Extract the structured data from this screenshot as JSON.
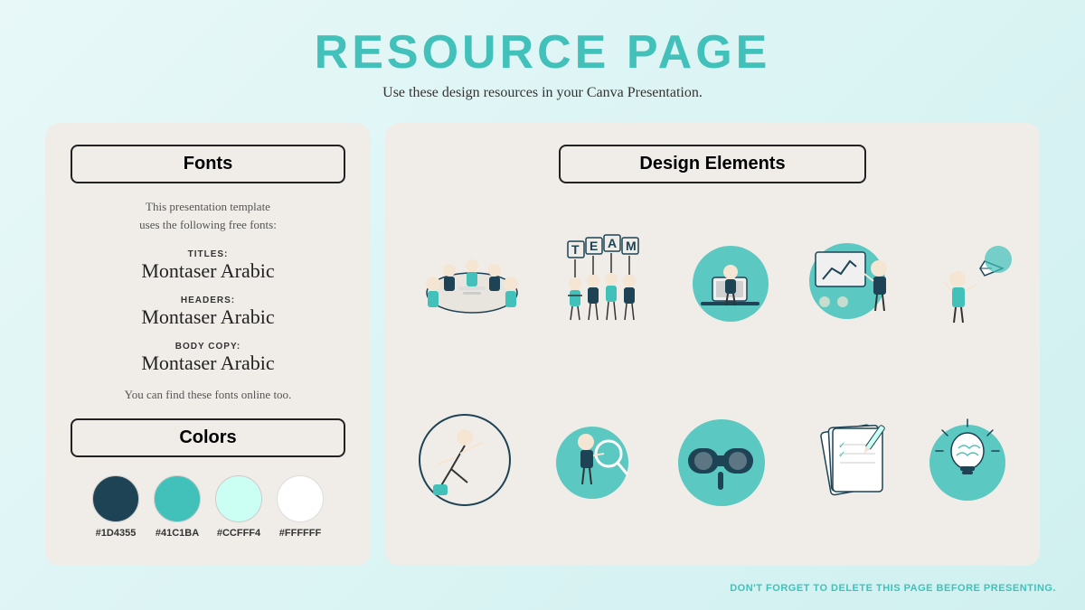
{
  "header": {
    "title": "RESOURCE PAGE",
    "subtitle": "Use these design resources in your Canva Presentation."
  },
  "left_panel": {
    "fonts_badge": "Fonts",
    "fonts_description": "This presentation template\nuses the following free fonts:",
    "font_entries": [
      {
        "label": "TITLES:",
        "name": "Montaser Arabic"
      },
      {
        "label": "HEADERS:",
        "name": "Montaser Arabic"
      },
      {
        "label": "BODY COPY:",
        "name": "Montaser Arabic"
      }
    ],
    "fonts_note": "You can find these fonts online too.",
    "colors_badge": "Colors",
    "color_swatches": [
      {
        "hex": "#1D4355",
        "label": "#1D4355"
      },
      {
        "hex": "#41C1BA",
        "label": "#41C1BA"
      },
      {
        "hex": "#CCFFF4",
        "label": "#CCFFF4"
      },
      {
        "hex": "#FFFFFF",
        "label": "#FFFFFF"
      }
    ]
  },
  "right_panel": {
    "badge": "Design Elements"
  },
  "footer": {
    "note": "DON'T FORGET TO DELETE THIS PAGE BEFORE PRESENTING."
  }
}
